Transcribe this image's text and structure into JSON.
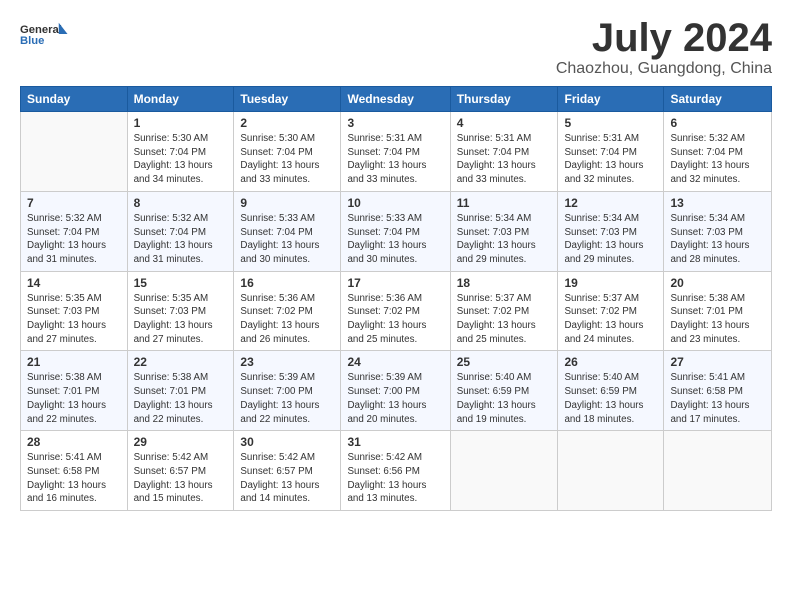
{
  "logo": {
    "general": "General",
    "blue": "Blue"
  },
  "title": {
    "month_year": "July 2024",
    "location": "Chaozhou, Guangdong, China"
  },
  "weekdays": [
    "Sunday",
    "Monday",
    "Tuesday",
    "Wednesday",
    "Thursday",
    "Friday",
    "Saturday"
  ],
  "weeks": [
    [
      {
        "day": "",
        "empty": true
      },
      {
        "day": "1",
        "sunrise": "5:30 AM",
        "sunset": "7:04 PM",
        "daylight": "13 hours and 34 minutes."
      },
      {
        "day": "2",
        "sunrise": "5:30 AM",
        "sunset": "7:04 PM",
        "daylight": "13 hours and 33 minutes."
      },
      {
        "day": "3",
        "sunrise": "5:31 AM",
        "sunset": "7:04 PM",
        "daylight": "13 hours and 33 minutes."
      },
      {
        "day": "4",
        "sunrise": "5:31 AM",
        "sunset": "7:04 PM",
        "daylight": "13 hours and 33 minutes."
      },
      {
        "day": "5",
        "sunrise": "5:31 AM",
        "sunset": "7:04 PM",
        "daylight": "13 hours and 32 minutes."
      },
      {
        "day": "6",
        "sunrise": "5:32 AM",
        "sunset": "7:04 PM",
        "daylight": "13 hours and 32 minutes."
      }
    ],
    [
      {
        "day": "7",
        "sunrise": "5:32 AM",
        "sunset": "7:04 PM",
        "daylight": "13 hours and 31 minutes."
      },
      {
        "day": "8",
        "sunrise": "5:32 AM",
        "sunset": "7:04 PM",
        "daylight": "13 hours and 31 minutes."
      },
      {
        "day": "9",
        "sunrise": "5:33 AM",
        "sunset": "7:04 PM",
        "daylight": "13 hours and 30 minutes."
      },
      {
        "day": "10",
        "sunrise": "5:33 AM",
        "sunset": "7:04 PM",
        "daylight": "13 hours and 30 minutes."
      },
      {
        "day": "11",
        "sunrise": "5:34 AM",
        "sunset": "7:03 PM",
        "daylight": "13 hours and 29 minutes."
      },
      {
        "day": "12",
        "sunrise": "5:34 AM",
        "sunset": "7:03 PM",
        "daylight": "13 hours and 29 minutes."
      },
      {
        "day": "13",
        "sunrise": "5:34 AM",
        "sunset": "7:03 PM",
        "daylight": "13 hours and 28 minutes."
      }
    ],
    [
      {
        "day": "14",
        "sunrise": "5:35 AM",
        "sunset": "7:03 PM",
        "daylight": "13 hours and 27 minutes."
      },
      {
        "day": "15",
        "sunrise": "5:35 AM",
        "sunset": "7:03 PM",
        "daylight": "13 hours and 27 minutes."
      },
      {
        "day": "16",
        "sunrise": "5:36 AM",
        "sunset": "7:02 PM",
        "daylight": "13 hours and 26 minutes."
      },
      {
        "day": "17",
        "sunrise": "5:36 AM",
        "sunset": "7:02 PM",
        "daylight": "13 hours and 25 minutes."
      },
      {
        "day": "18",
        "sunrise": "5:37 AM",
        "sunset": "7:02 PM",
        "daylight": "13 hours and 25 minutes."
      },
      {
        "day": "19",
        "sunrise": "5:37 AM",
        "sunset": "7:02 PM",
        "daylight": "13 hours and 24 minutes."
      },
      {
        "day": "20",
        "sunrise": "5:38 AM",
        "sunset": "7:01 PM",
        "daylight": "13 hours and 23 minutes."
      }
    ],
    [
      {
        "day": "21",
        "sunrise": "5:38 AM",
        "sunset": "7:01 PM",
        "daylight": "13 hours and 22 minutes."
      },
      {
        "day": "22",
        "sunrise": "5:38 AM",
        "sunset": "7:01 PM",
        "daylight": "13 hours and 22 minutes."
      },
      {
        "day": "23",
        "sunrise": "5:39 AM",
        "sunset": "7:00 PM",
        "daylight": "13 hours and 22 minutes."
      },
      {
        "day": "24",
        "sunrise": "5:39 AM",
        "sunset": "7:00 PM",
        "daylight": "13 hours and 20 minutes."
      },
      {
        "day": "25",
        "sunrise": "5:40 AM",
        "sunset": "6:59 PM",
        "daylight": "13 hours and 19 minutes."
      },
      {
        "day": "26",
        "sunrise": "5:40 AM",
        "sunset": "6:59 PM",
        "daylight": "13 hours and 18 minutes."
      },
      {
        "day": "27",
        "sunrise": "5:41 AM",
        "sunset": "6:58 PM",
        "daylight": "13 hours and 17 minutes."
      }
    ],
    [
      {
        "day": "28",
        "sunrise": "5:41 AM",
        "sunset": "6:58 PM",
        "daylight": "13 hours and 16 minutes."
      },
      {
        "day": "29",
        "sunrise": "5:42 AM",
        "sunset": "6:57 PM",
        "daylight": "13 hours and 15 minutes."
      },
      {
        "day": "30",
        "sunrise": "5:42 AM",
        "sunset": "6:57 PM",
        "daylight": "13 hours and 14 minutes."
      },
      {
        "day": "31",
        "sunrise": "5:42 AM",
        "sunset": "6:56 PM",
        "daylight": "13 hours and 13 minutes."
      },
      {
        "day": "",
        "empty": true
      },
      {
        "day": "",
        "empty": true
      },
      {
        "day": "",
        "empty": true
      }
    ]
  ],
  "labels": {
    "sunrise": "Sunrise:",
    "sunset": "Sunset:",
    "daylight": "Daylight:"
  }
}
